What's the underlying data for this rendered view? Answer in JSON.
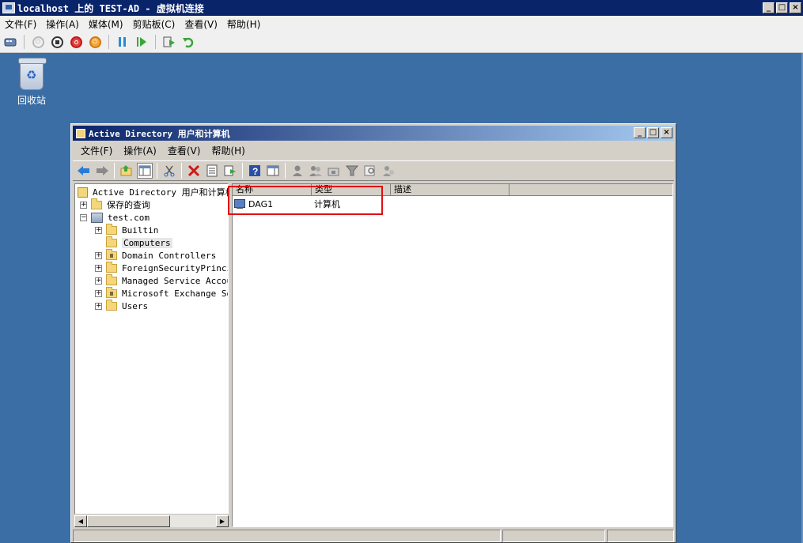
{
  "vm_window": {
    "title": "localhost 上的 TEST-AD - 虚拟机连接",
    "menu": [
      "文件(F)",
      "操作(A)",
      "媒体(M)",
      "剪贴板(C)",
      "查看(V)",
      "帮助(H)"
    ],
    "toolbar_icons": [
      "ctrl-alt-del-icon",
      "start-icon",
      "turn-off-icon",
      "shut-down-icon",
      "save-state-icon",
      "pause-icon",
      "resume-icon",
      "snapshot-icon",
      "revert-icon"
    ]
  },
  "desktop": {
    "recycle_bin_label": "回收站"
  },
  "ad_window": {
    "title": "Active Directory 用户和计算机",
    "menu": [
      "文件(F)",
      "操作(A)",
      "查看(V)",
      "帮助(H)"
    ],
    "tree": {
      "root": "Active Directory 用户和计算机",
      "saved_queries": "保存的查询",
      "domain": "test.com",
      "children": [
        "Builtin",
        "Computers",
        "Domain Controllers",
        "ForeignSecurityPrincip",
        "Managed Service Accour",
        "Microsoft Exchange Sec",
        "Users"
      ],
      "selected": "Computers"
    },
    "list": {
      "columns": [
        "名称",
        "类型",
        "描述"
      ],
      "rows": [
        {
          "name": "DAG1",
          "type": "计算机",
          "description": ""
        }
      ]
    },
    "colors": {
      "highlight_box": "#e01010",
      "title_gradient_start": "#0a246a",
      "desktop": "#3a6ea5"
    }
  }
}
